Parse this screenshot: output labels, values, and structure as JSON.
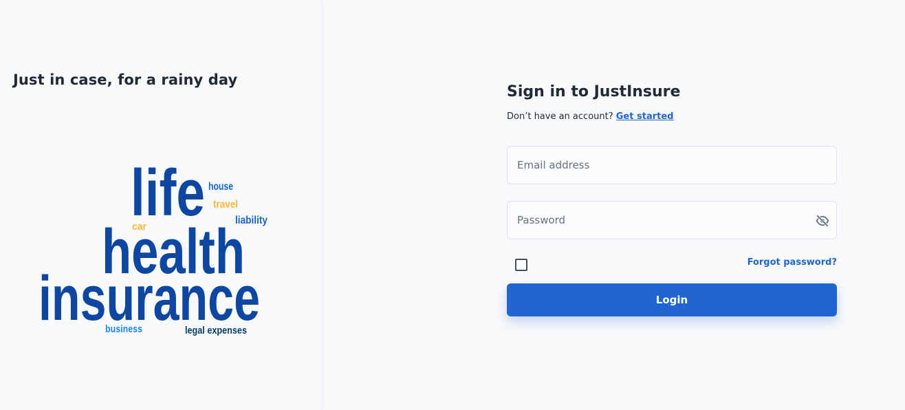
{
  "hero": {
    "tagline": "Just in case, for a rainy day",
    "word_cloud": {
      "words": [
        {
          "text": "life",
          "color": "#0d47a1"
        },
        {
          "text": "health",
          "color": "#0d47a1"
        },
        {
          "text": "insurance",
          "color": "#0d47a1"
        },
        {
          "text": "house",
          "color": "#1565c0"
        },
        {
          "text": "travel",
          "color": "#f6b93b"
        },
        {
          "text": "liability",
          "color": "#1565c0"
        },
        {
          "text": "car",
          "color": "#f6b93b"
        },
        {
          "text": "business",
          "color": "#1e88e5"
        },
        {
          "text": "legal expenses",
          "color": "#0b3d6b"
        }
      ]
    }
  },
  "login": {
    "title": "Sign in to JustInsure",
    "no_account_text": "Don’t have an account?",
    "get_started_label": "Get started",
    "email_placeholder": "Email address",
    "email_value": "",
    "password_placeholder": "Password",
    "password_value": "",
    "password_toggle_icon": "eye-off-icon",
    "remember_checked": false,
    "forgot_password_label": "Forgot password?",
    "login_button_label": "Login"
  },
  "colors": {
    "primary": "#2065d1",
    "background": "#f8f9fb",
    "text": "#212b36"
  }
}
